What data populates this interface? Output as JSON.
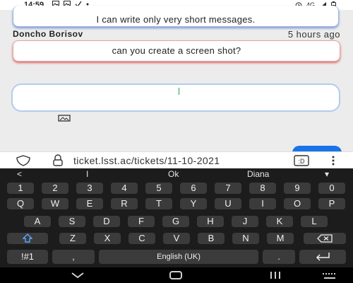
{
  "status_bar": {
    "time": "14:59",
    "left_icons": [
      "gallery-icon",
      "gallery-icon",
      "check-icon",
      "dot-icon"
    ],
    "right_icons": [
      "alarm-icon",
      "4g-icon",
      "signal-icon",
      "battery-icon"
    ],
    "network_label": "4G"
  },
  "chat": {
    "messages": [
      {
        "text": "I can write only very short messages."
      },
      {
        "author": "Doncho Borisov",
        "time": "5 hours ago",
        "text": "can you create a screen shot?"
      }
    ],
    "reply_placeholder": ""
  },
  "url_bar": {
    "url": "ticket.lsst.ac/tickets/11-10-2021",
    "tab_count": ":D"
  },
  "keyboard": {
    "suggestions": [
      "<",
      "I",
      "Ok",
      "Diana",
      "▾"
    ],
    "row_numbers": [
      "1",
      "2",
      "3",
      "4",
      "5",
      "6",
      "7",
      "8",
      "9",
      "0"
    ],
    "row_q": [
      "Q",
      "W",
      "E",
      "R",
      "T",
      "Y",
      "U",
      "I",
      "O",
      "P"
    ],
    "row_a": [
      "A",
      "S",
      "D",
      "F",
      "G",
      "H",
      "J",
      "K",
      "L"
    ],
    "row_z": [
      "Z",
      "X",
      "C",
      "V",
      "B",
      "N",
      "M"
    ],
    "symbols_label": "!#1",
    "comma_label": ",",
    "space_label": "English (UK)",
    "period_label": "."
  },
  "colors": {
    "accent_blue": "#1a73e8",
    "caret_green": "#16a34a",
    "bubble_shadow_blue": "#7d9bd4",
    "bubble_shadow_red": "#e06a6a"
  }
}
